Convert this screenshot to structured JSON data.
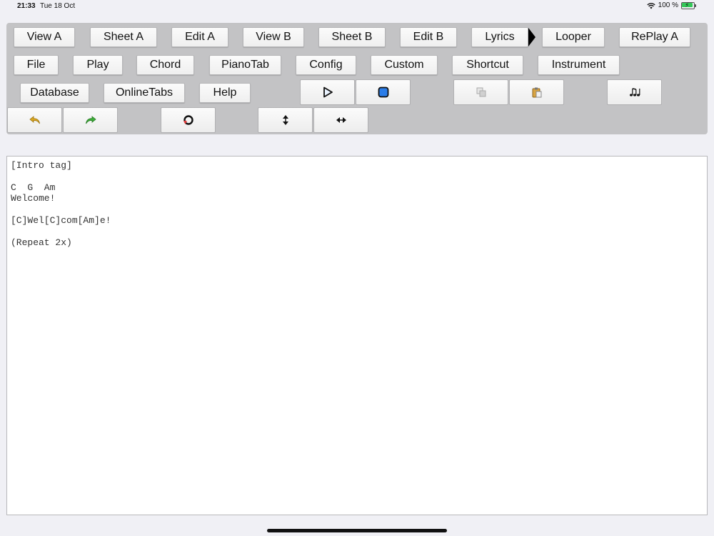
{
  "status_bar": {
    "time": "21:33",
    "date": "Tue 18 Oct",
    "battery": "100 %"
  },
  "toolbar": {
    "row1": [
      "View A",
      "Sheet A",
      "Edit A",
      "View B",
      "Sheet B",
      "Edit B",
      "Lyrics",
      "Looper",
      "RePlay A"
    ],
    "row2": [
      "File",
      "Play",
      "Chord",
      "PianoTab",
      "Config",
      "Custom",
      "Shortcut",
      "Instrument"
    ],
    "row3": [
      "Database",
      "OnlineTabs",
      "Help"
    ],
    "icons": {
      "play": "play-icon",
      "stop": "stop-icon",
      "copy": "copy-icon",
      "paste": "paste-icon",
      "music_notes": "music-notes-icon",
      "undo": "undo-icon",
      "redo": "redo-icon",
      "reload": "reload-icon",
      "vertical_resize": "vertical-resize-icon",
      "horizontal_resize": "horizontal-resize-icon"
    },
    "colors": {
      "panel": "#c3c3c5",
      "play_accent": "#2b7de9",
      "undo": "#d8a521",
      "redo": "#3fae3a"
    }
  },
  "editor": {
    "lines": [
      "[Intro tag]",
      "",
      "C  G  Am",
      "Welcome!",
      "",
      "[C]Wel[C]com[Am]e!",
      "",
      "(Repeat 2x)"
    ]
  }
}
